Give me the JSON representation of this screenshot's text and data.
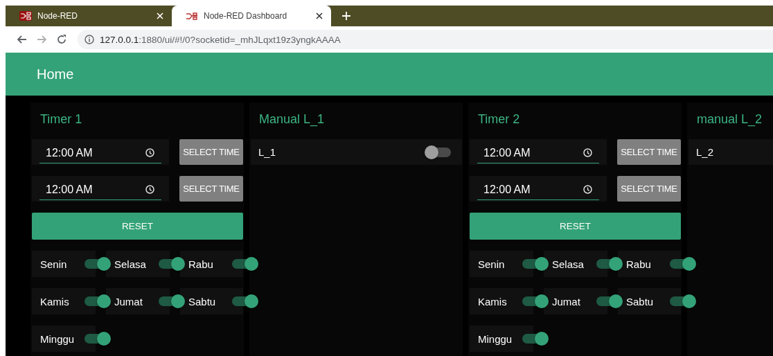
{
  "browser": {
    "tabs": [
      {
        "title": "Node-RED",
        "selected": false
      },
      {
        "title": "Node-RED Dashboard",
        "selected": true
      }
    ],
    "address": {
      "host": "127.0.0.1",
      "path": ":1880/ui/#!/0?socketid=_mhJLqxt19z3yngkAAAA"
    }
  },
  "toolbar": {
    "title": "Home"
  },
  "groups": [
    {
      "kind": "timer",
      "title": "Timer 1",
      "times": [
        {
          "value": "12:00 AM",
          "button": "SELECT TIME"
        },
        {
          "value": "12:00 AM",
          "button": "SELECT TIME"
        }
      ],
      "reset": "RESET",
      "days": [
        {
          "label": "Senin",
          "on": true
        },
        {
          "label": "Selasa",
          "on": true
        },
        {
          "label": "Rabu",
          "on": true
        },
        {
          "label": "Kamis",
          "on": true
        },
        {
          "label": "Jumat",
          "on": true
        },
        {
          "label": "Sabtu",
          "on": true
        },
        {
          "label": "Minggu",
          "on": true
        }
      ]
    },
    {
      "kind": "manual",
      "title": "Manual L_1",
      "switches": [
        {
          "label": "L_1",
          "on": false
        }
      ]
    },
    {
      "kind": "timer",
      "title": "Timer 2",
      "times": [
        {
          "value": "12:00 AM",
          "button": "SELECT TIME"
        },
        {
          "value": "12:00 AM",
          "button": "SELECT TIME"
        }
      ],
      "reset": "RESET",
      "days": [
        {
          "label": "Senin",
          "on": true
        },
        {
          "label": "Selasa",
          "on": true
        },
        {
          "label": "Rabu",
          "on": true
        },
        {
          "label": "Kamis",
          "on": true
        },
        {
          "label": "Jumat",
          "on": true
        },
        {
          "label": "Sabtu",
          "on": true
        },
        {
          "label": "Minggu",
          "on": true
        }
      ]
    },
    {
      "kind": "manual",
      "title": "manual L_2",
      "switches": [
        {
          "label": "L_2"
        }
      ]
    }
  ]
}
